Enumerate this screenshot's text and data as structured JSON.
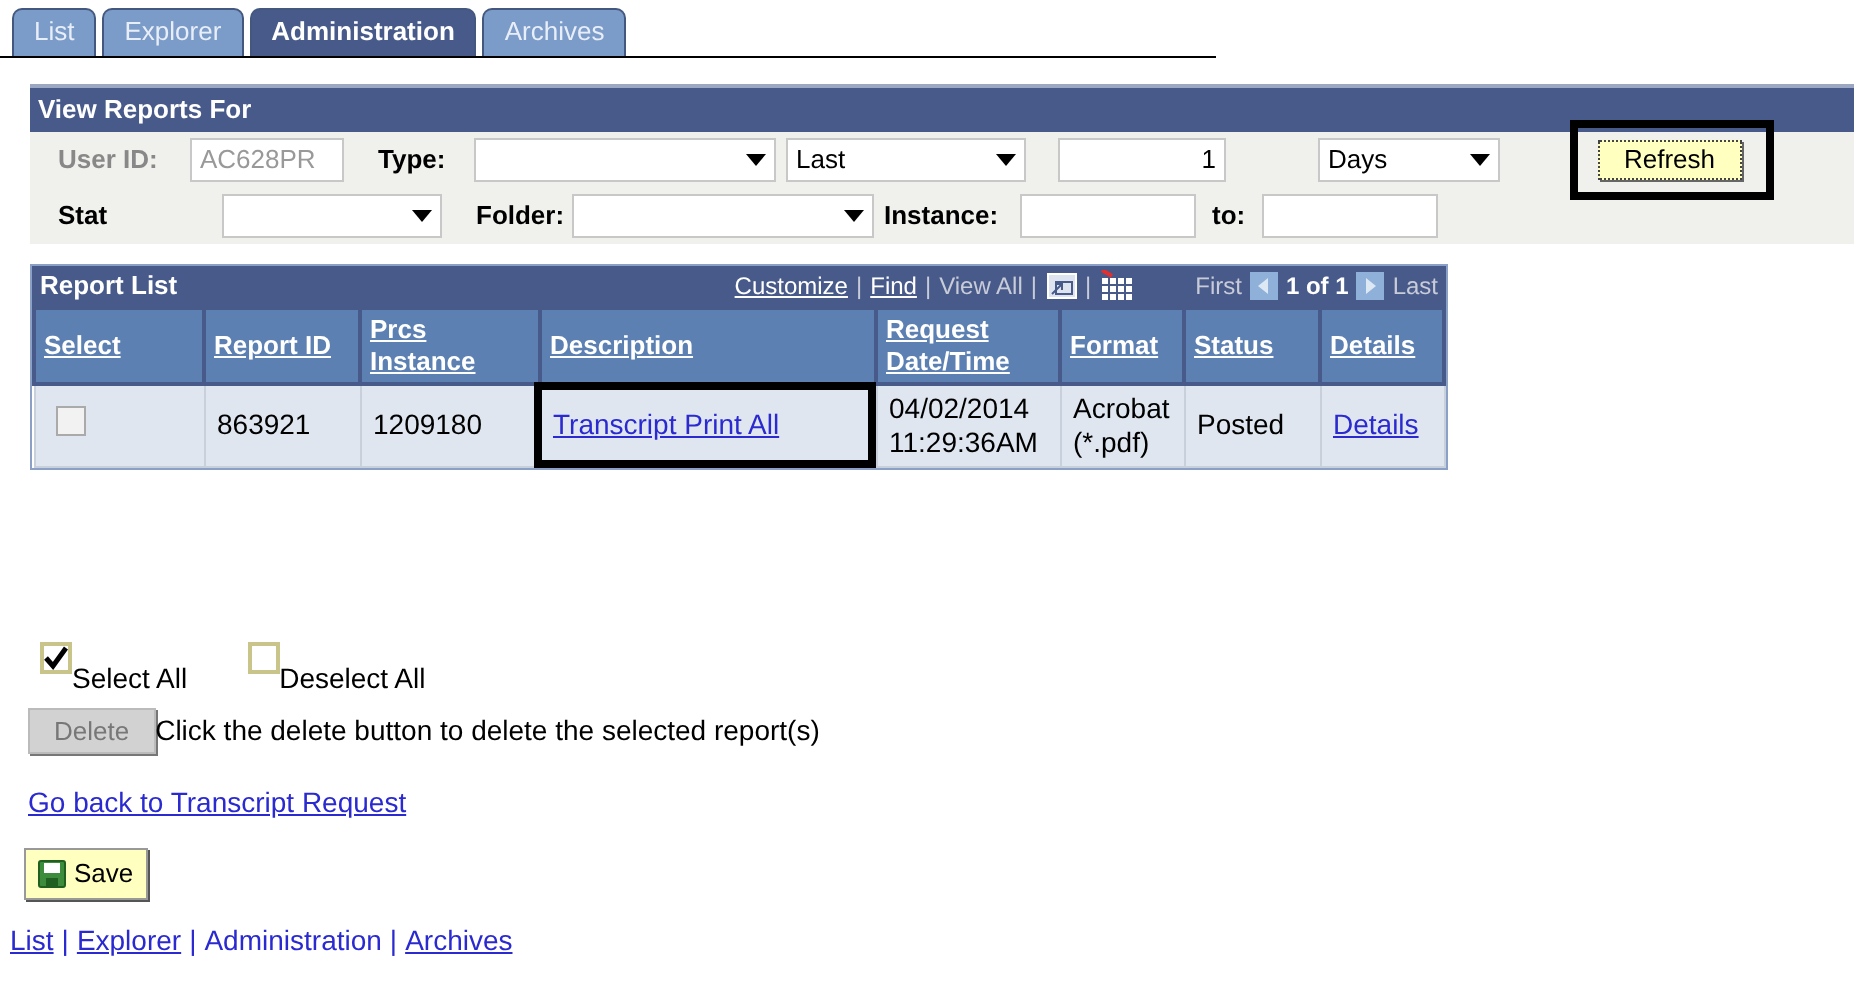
{
  "tabs": [
    {
      "label": "List",
      "selected": false
    },
    {
      "label": "Explorer",
      "selected": false
    },
    {
      "label": "Administration",
      "selected": true
    },
    {
      "label": "Archives",
      "selected": false
    }
  ],
  "view_reports_for": {
    "title": "View Reports For",
    "user_id": {
      "label": "User ID:",
      "value": "AC628PR",
      "disabled": true
    },
    "type": {
      "label": "Type:"
    },
    "period": {
      "value": "Last"
    },
    "count": {
      "value": "1"
    },
    "unit": {
      "value": "Days"
    },
    "refresh_button": {
      "label": "Refresh",
      "highlighted": true
    },
    "status": {
      "label": "Stat"
    },
    "folder": {
      "label": "Folder:"
    },
    "instance": {
      "label": "Instance:"
    },
    "instance_to": {
      "label": "to:"
    }
  },
  "report_list": {
    "title": "Report List",
    "toolbar": {
      "separator": "|",
      "links": [
        {
          "label": "Customize",
          "disabled": false
        },
        {
          "label": "Find",
          "disabled": false
        },
        {
          "label": "View All",
          "disabled": true
        }
      ],
      "first": "First",
      "page": "1 of 1",
      "last": "Last"
    },
    "columns": [
      "Select",
      "Report ID",
      "Prcs Instance",
      "Description",
      "Request Date/Time",
      "Format",
      "Status",
      "Details"
    ],
    "rows": [
      {
        "checked": false,
        "report_id": "863921",
        "prcs_instance": "1209180",
        "description": "Transcript Print All",
        "description_highlighted": true,
        "date": "04/02/2014",
        "time": "11:29:36AM",
        "format": "Acrobat",
        "format_ext": "(*.pdf)",
        "status": "Posted",
        "details": "Details"
      }
    ]
  },
  "select_all": {
    "label": "Select All",
    "checked": true
  },
  "deselect_all": {
    "label": "Deselect All",
    "checked": false
  },
  "delete_button": {
    "label": "Delete",
    "disabled": true
  },
  "delete_hint": "Click the delete button to delete the selected report(s)",
  "back_link": "Go back to Transcript Request",
  "save_button": "Save",
  "footer_separator": "|",
  "footer_links": [
    {
      "label": "List",
      "selected": false
    },
    {
      "label": "Explorer",
      "selected": false
    },
    {
      "label": "Administration",
      "selected": true
    },
    {
      "label": "Archives",
      "selected": false
    }
  ]
}
